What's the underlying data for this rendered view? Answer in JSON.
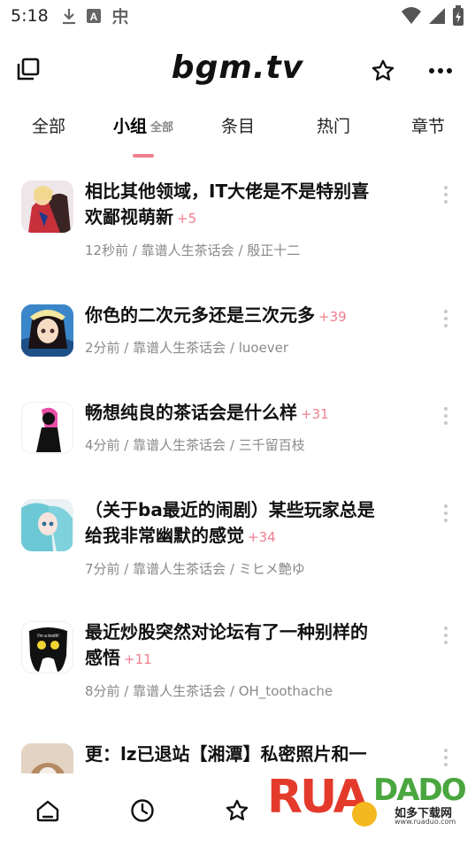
{
  "status_bar": {
    "time": "5:18",
    "icons": [
      "download-icon",
      "a-icon",
      "notification-icon"
    ],
    "right_icons": [
      "wifi-icon",
      "signal-icon",
      "battery-icon"
    ]
  },
  "app_bar": {
    "title": "bgm.tv"
  },
  "tabs": [
    {
      "label": "全部",
      "sub": ""
    },
    {
      "label": "小组",
      "sub": "全部"
    },
    {
      "label": "条目",
      "sub": ""
    },
    {
      "label": "热门",
      "sub": ""
    },
    {
      "label": "章节",
      "sub": ""
    }
  ],
  "active_tab": "小组",
  "feed": [
    {
      "title_line1": "相比其他领域，IT大佬是不是特别喜",
      "title_line2": "欢鄙视萌新",
      "count": "+5",
      "meta": "12秒前 / 靠谱人生茶话会 / 殷正十二"
    },
    {
      "title_line1": "你色的二次元多还是三次元多",
      "title_line2": "",
      "count": "+39",
      "meta": "2分前 / 靠谱人生茶话会 / luoever"
    },
    {
      "title_line1": "畅想纯良的茶话会是什么样",
      "title_line2": "",
      "count": "+31",
      "meta": "4分前 / 靠谱人生茶话会 / 三千留百枝"
    },
    {
      "title_line1": "（关于ba最近的闹剧）某些玩家总是",
      "title_line2": "给我非常幽默的感觉",
      "count": "+34",
      "meta": "7分前 / 靠谱人生茶话会 / ミヒメ艶ゆ"
    },
    {
      "title_line1": "最近炒股突然对论坛有了一种别样的",
      "title_line2": "感悟",
      "count": "+11",
      "meta": "8分前 / 靠谱人生茶话会 / OH_toothache"
    },
    {
      "title_line1": "更：lz已退站【湘潭】私密照片和一",
      "title_line2": "",
      "count": "",
      "meta": ""
    }
  ],
  "bottom_nav": [
    "home-icon",
    "timeline-icon",
    "favorites-icon"
  ],
  "watermark": {
    "brand": "RUANDADO",
    "cn": "如多下载网",
    "url": "www.ruaduo.com"
  },
  "colors": {
    "accent": "#f07e8e",
    "meta_text": "#8a8a8a"
  }
}
